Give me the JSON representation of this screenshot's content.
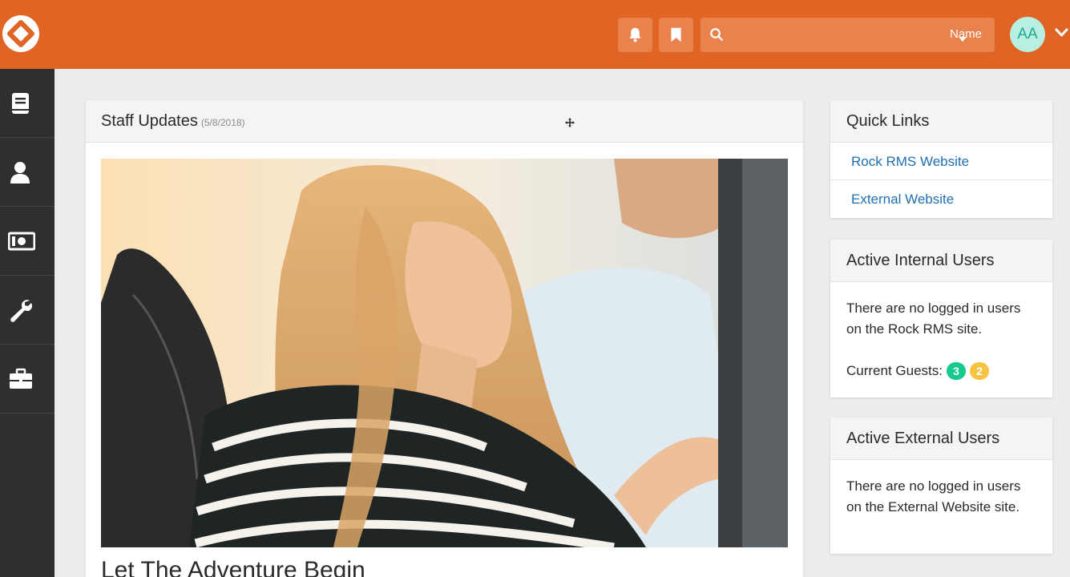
{
  "header": {
    "search": {
      "placeholder": "",
      "filter_label": "Name"
    },
    "avatar_initials": "AA",
    "icons": [
      "rock-logo-icon",
      "bell-icon",
      "bookmark-icon",
      "search-icon",
      "chevron-down-icon"
    ]
  },
  "sidebar": {
    "items": [
      {
        "icon": "book-icon"
      },
      {
        "icon": "person-icon"
      },
      {
        "icon": "money-icon"
      },
      {
        "icon": "wrench-icon"
      },
      {
        "icon": "briefcase-icon"
      }
    ]
  },
  "main": {
    "title": "Staff Updates",
    "date": "(5/8/2018)",
    "article_title": "Let The Adventure Begin"
  },
  "quick_links": {
    "title": "Quick Links",
    "links": [
      "Rock RMS Website",
      "External Website"
    ]
  },
  "internal_users": {
    "title": "Active Internal Users",
    "message": "There are no logged in users on the Rock RMS site.",
    "guests_label": "Current Guests:",
    "guest_counts": [
      "3",
      "2"
    ]
  },
  "external_users": {
    "title": "Active External Users",
    "message": "There are no logged in users on the External Website site."
  },
  "colors": {
    "brand": "#e06423",
    "sidebar": "#2f2f2f",
    "link": "#1f6fb2",
    "badge_green": "#16c98d",
    "badge_yellow": "#f6c343"
  }
}
